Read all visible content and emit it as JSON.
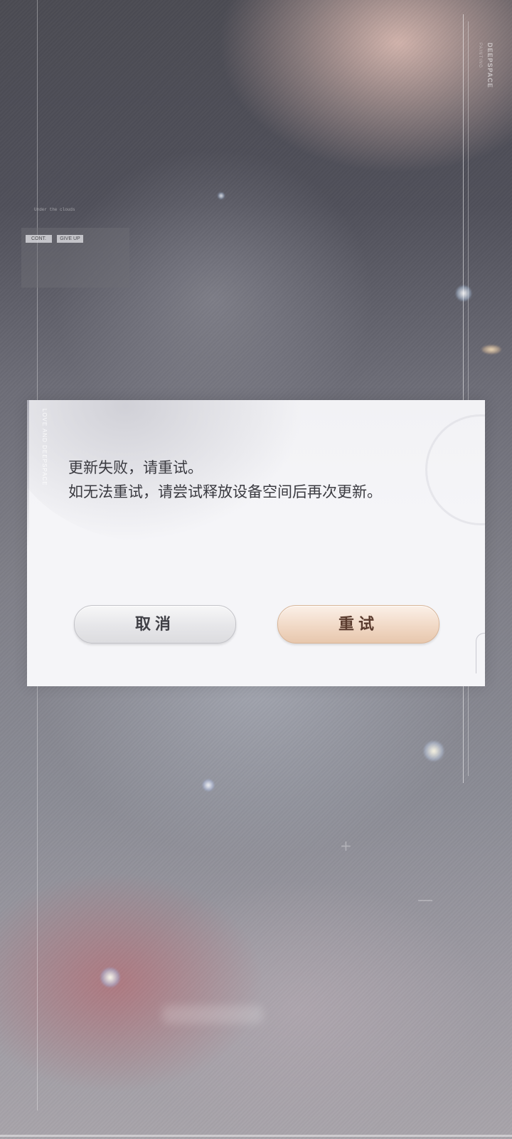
{
  "background": {
    "brand": "DEEPSPACE",
    "brand_sub": "PAINTING",
    "status_card": {
      "line1": "Under the clouds",
      "line2": "",
      "chips": [
        "CONT.",
        "GIVE UP"
      ]
    }
  },
  "dialog": {
    "side_text": "LOVE AND DEEPSPACE",
    "message_line1": "更新失败，请重试。",
    "message_line2": "如无法重试，请尝试释放设备空间后再次更新。",
    "cancel_label": "取消",
    "retry_label": "重试"
  },
  "colors": {
    "retry_button": "#f1d9c6",
    "cancel_button": "#e6e6e9",
    "dialog_bg": "#f5f5f8",
    "message_text": "#3a3a40"
  }
}
